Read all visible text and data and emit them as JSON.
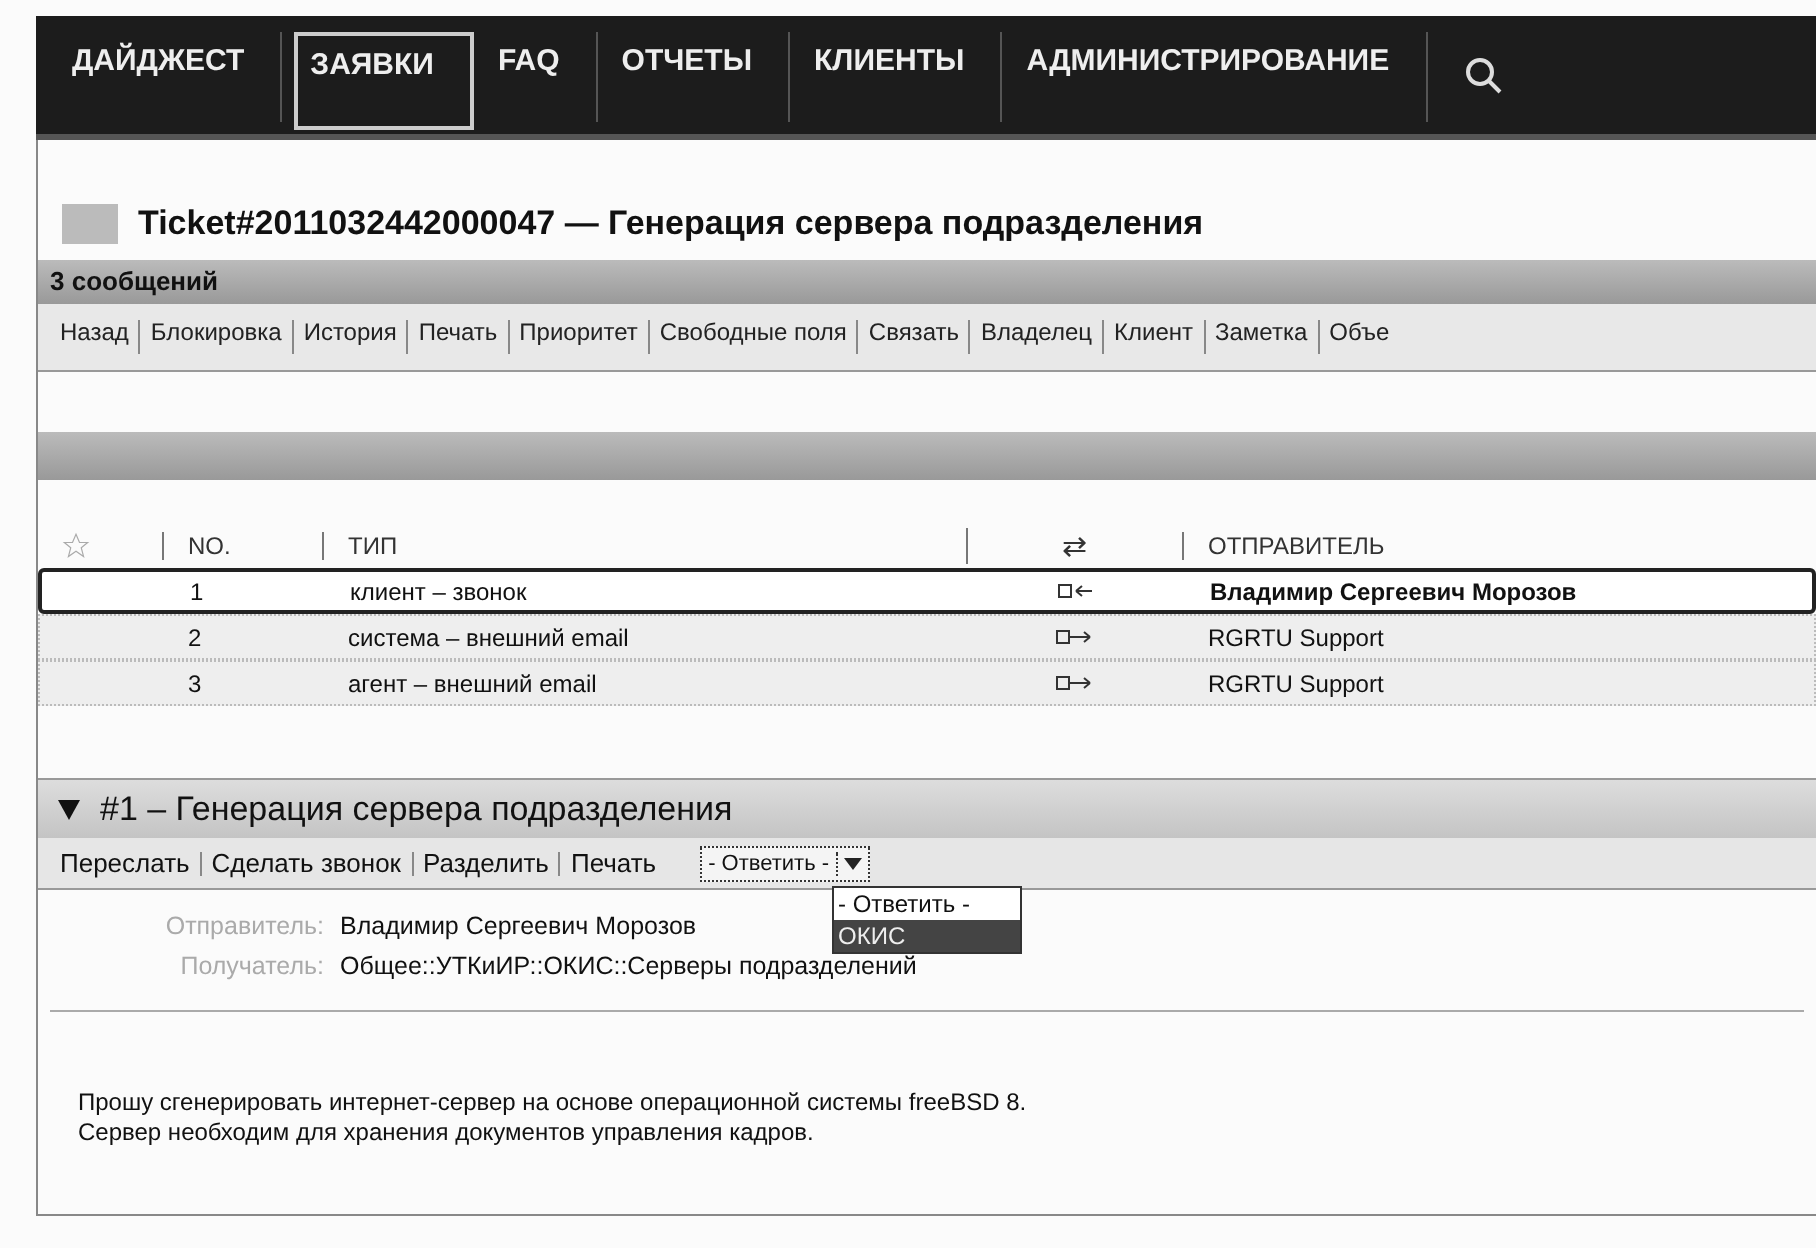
{
  "nav": {
    "items": [
      {
        "label": "ДАЙДЖЕСТ",
        "selected": false
      },
      {
        "label": "ЗАЯВКИ",
        "selected": true
      },
      {
        "label": "FAQ",
        "selected": false
      },
      {
        "label": "ОТЧЕТЫ",
        "selected": false
      },
      {
        "label": "КЛИЕНТЫ",
        "selected": false
      },
      {
        "label": "АДМИНИСТРИРОВАНИЕ",
        "selected": false
      }
    ]
  },
  "ticket": {
    "title": "Ticket#2011032442000047 — Генерация сервера подразделения"
  },
  "messages_bar": {
    "label": "3 сообщений"
  },
  "ticket_actions": [
    "Назад",
    "Блокировка",
    "История",
    "Печать",
    "Приоритет",
    "Свободные поля",
    "Связать",
    "Владелец",
    "Клиент",
    "Заметка",
    "Объе"
  ],
  "table": {
    "columns": [
      "NO.",
      "ТИП",
      "⇄",
      "ОТПРАВИТЕЛЬ"
    ],
    "rows": [
      {
        "no": "1",
        "type": "клиент – звонок",
        "kind": "incoming",
        "sender": "Владимир Сергеевич Морозов",
        "selected": true
      },
      {
        "no": "2",
        "type": "система – внешний email",
        "kind": "outgoing",
        "sender": "RGRTU Support",
        "selected": false
      },
      {
        "no": "3",
        "type": "агент – внешний email",
        "kind": "outgoing",
        "sender": "RGRTU Support",
        "selected": false
      }
    ]
  },
  "article": {
    "expanded": true,
    "title": "#1 – Генерация сервера подразделения",
    "actions": [
      "Переслать",
      "Сделать звонок",
      "Разделить",
      "Печать"
    ],
    "reply_select": {
      "value": "- Ответить -",
      "expanded": true,
      "options": [
        {
          "label": "- Ответить -",
          "highlighted": false
        },
        {
          "label": "ОКИС",
          "highlighted": true
        }
      ]
    },
    "fields": [
      {
        "label": "Отправитель:",
        "value": "Владимир Сергеевич Морозов"
      },
      {
        "label": "Получатель:",
        "value": "Общее::УТКиИР::ОКИС::Серверы подразделений"
      }
    ],
    "body": [
      "Прошу сгенерировать интернет-сервер на основе операционной системы freeBSD 8.",
      "Сервер необходим для хранения документов управления кадров."
    ]
  }
}
